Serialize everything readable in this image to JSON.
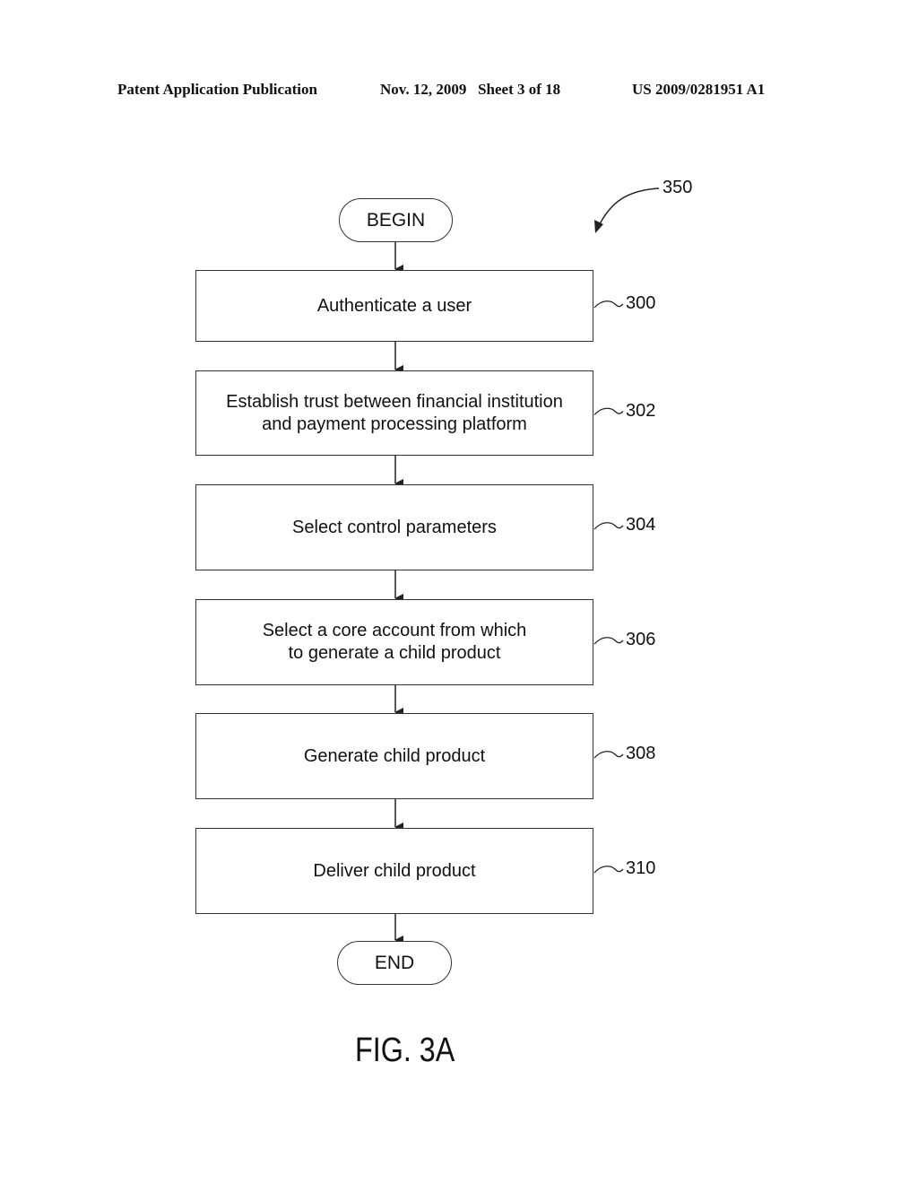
{
  "header": {
    "left": "Patent Application Publication",
    "middle": "Nov. 12, 2009   Sheet 3 of 18",
    "right": "US 2009/0281951 A1"
  },
  "diagram": {
    "figure_ref": "350",
    "begin": "BEGIN",
    "end": "END",
    "steps": [
      {
        "ref": "300",
        "lines": [
          "Authenticate a user"
        ]
      },
      {
        "ref": "302",
        "lines": [
          "Establish trust between financial institution",
          "and payment processing platform"
        ]
      },
      {
        "ref": "304",
        "lines": [
          "Select control parameters"
        ]
      },
      {
        "ref": "306",
        "lines": [
          "Select a core account from which",
          "to generate a child product"
        ]
      },
      {
        "ref": "308",
        "lines": [
          "Generate child product"
        ]
      },
      {
        "ref": "310",
        "lines": [
          "Deliver child product"
        ]
      }
    ],
    "caption": "FIG. 3A"
  }
}
